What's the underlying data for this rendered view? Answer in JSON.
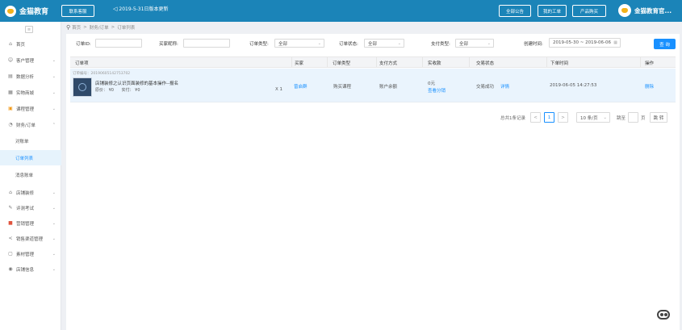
{
  "header": {
    "logo_text": "金猫教育",
    "contact_button": "联系客服",
    "notice": "2019-5-31日版本更新",
    "all_announcements": "全部公告",
    "my_tickets": "我的工单",
    "buy_products": "产品购买",
    "brand_name": "金猫教育官..."
  },
  "sidebar": {
    "collapse_icon": "≡",
    "items": [
      {
        "icon": "⌂",
        "label": "首页"
      },
      {
        "icon": "☺",
        "label": "客户管理"
      },
      {
        "icon": "▤",
        "label": "数据分析"
      },
      {
        "icon": "▦",
        "label": "实物商城"
      },
      {
        "icon": "▣",
        "label": "课程管理"
      },
      {
        "icon": "◔",
        "label": "财务/订单"
      },
      {
        "icon": "⌂",
        "label": "店铺装修"
      },
      {
        "icon": "✎",
        "label": "评测考试"
      },
      {
        "icon": "■",
        "label": "营销管理"
      },
      {
        "icon": "<",
        "label": "销售渠道管理"
      },
      {
        "icon": "▢",
        "label": "素材管理"
      },
      {
        "icon": "◉",
        "label": "店铺信息"
      }
    ],
    "sub_items": [
      {
        "label": "对账单"
      },
      {
        "label": "订单列表"
      },
      {
        "label": "消息账单"
      }
    ]
  },
  "breadcrumb": {
    "home": "首页",
    "sep1": ">",
    "section": "财务/订单",
    "sep2": ">",
    "page": "订单列表"
  },
  "filters": {
    "order_id_label": "订单ID:",
    "order_id_value": "",
    "buyer_label": "买家昵称:",
    "buyer_value": "",
    "order_type_label": "订单类型:",
    "order_type_value": "全部",
    "order_status_label": "订单状态:",
    "order_status_value": "全部",
    "pay_type_label": "支付类型:",
    "pay_type_value": "全部",
    "created_label": "创建时间:",
    "created_value": "2019-05-30 ~ 2019-06-06",
    "query_button": "查 询"
  },
  "table": {
    "columns": [
      "订单项",
      "买家",
      "订单类型",
      "支付方式",
      "实收款",
      "交易状态",
      "下单时间",
      "操作"
    ],
    "rows": [
      {
        "order_no": "订单编号：20190605142753702",
        "title": "店铺装修之认识页面装修的基本操作--报名",
        "original_price": "原价：  ¥0",
        "paid": "实付：  ¥0",
        "qty": "X 1",
        "buyer": "曾启群",
        "order_type": "购买课程",
        "pay_method": "账户余额",
        "amount": "0元",
        "view_split": "查看分销",
        "status": "交易成功",
        "detail": "详情",
        "time": "2019-06-05 14:27:53",
        "action": "删除"
      }
    ]
  },
  "pagination": {
    "total": "总共1条记录",
    "prev": "<",
    "current": "1",
    "next": ">",
    "page_size": "10 条/页",
    "jump_label": "跳至",
    "jump_value": "",
    "page_unit": "页",
    "go": "跳 转"
  },
  "colors": {
    "header_bg": "#1b84b8",
    "accent": "#1890ff",
    "row_bg": "#eaf4fd"
  },
  "icons": {
    "bell": "bell-icon",
    "pin": "location-pin-icon",
    "calendar": "calendar-icon",
    "robot": "robot-icon"
  }
}
